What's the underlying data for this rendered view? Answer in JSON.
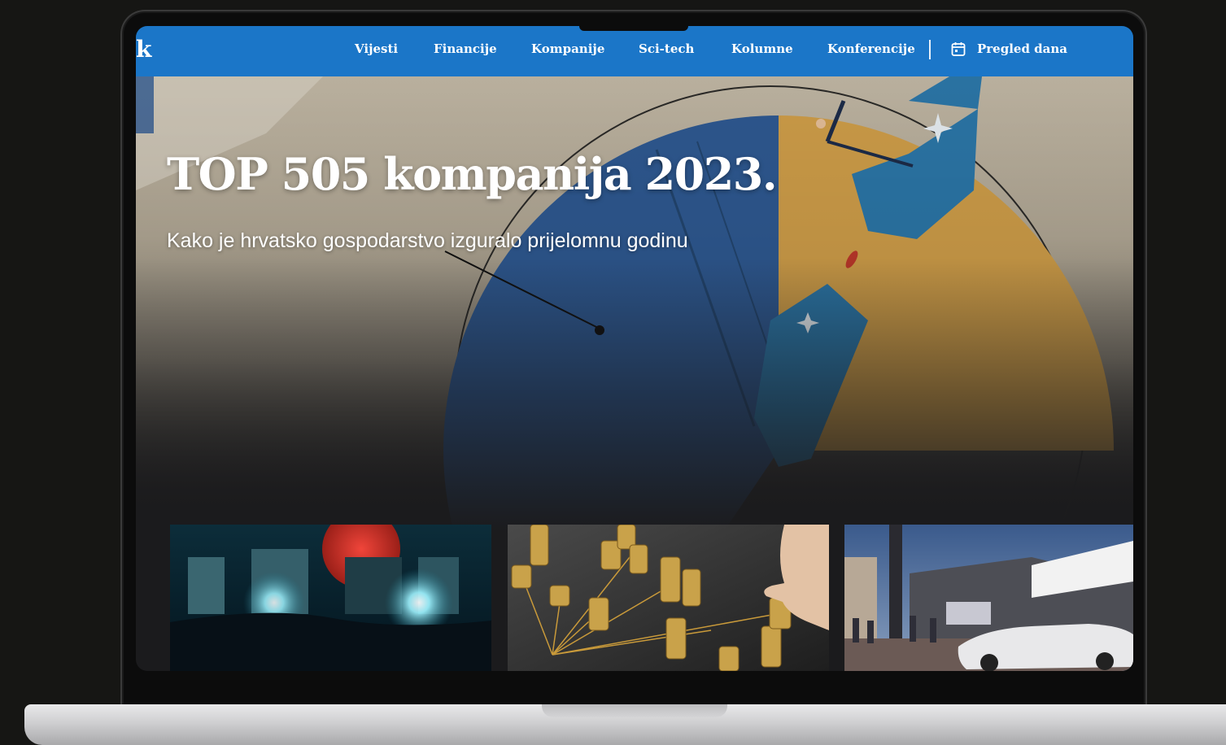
{
  "brand": {
    "logo_letter": "k"
  },
  "nav": {
    "items": [
      {
        "label": "Vijesti"
      },
      {
        "label": "Financije"
      },
      {
        "label": "Kompanije"
      },
      {
        "label": "Sci-tech"
      },
      {
        "label": "Kolumne"
      },
      {
        "label": "Konferencije"
      }
    ],
    "daily_overview": {
      "label": "Pregled dana",
      "icon": "calendar-icon"
    }
  },
  "hero": {
    "title": "TOP 505 kompanija 2023.",
    "subtitle": "Kako je hrvatsko gospodarstvo izguralo prijelomnu godinu"
  },
  "cards": [
    {
      "image": "night-city-red-moon"
    },
    {
      "image": "stacked-coins-network"
    },
    {
      "image": "street-sports-car"
    }
  ],
  "colors": {
    "nav_bg": "#1b76c8",
    "pie_blue": "#2f5a93",
    "pie_gold": "#d2a04a"
  }
}
